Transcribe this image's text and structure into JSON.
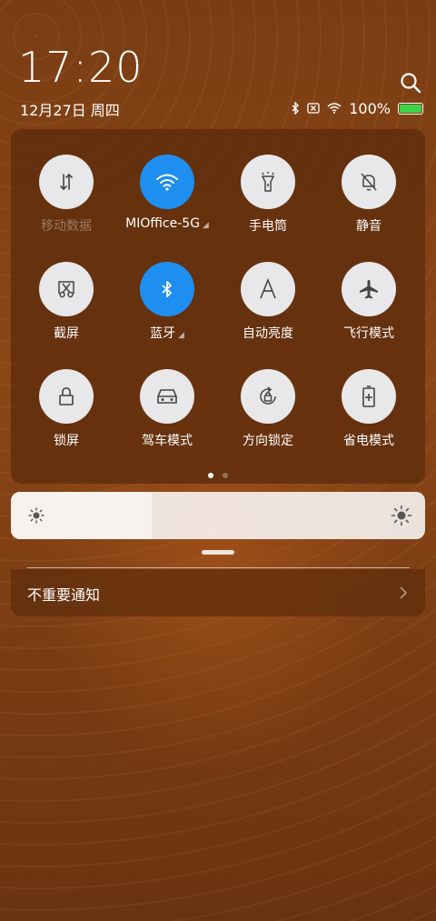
{
  "status": {
    "time": "17:20",
    "date": "12月27日 周四",
    "battery": "100%",
    "battery_level": 1.0,
    "battery_color": "#3ed44a"
  },
  "tiles": [
    {
      "label": "移动数据",
      "icon": "mobile-data-icon",
      "active": false,
      "dim": true
    },
    {
      "label": "MIOffice-5G",
      "icon": "wifi-icon",
      "active": true,
      "sub_indicator": true
    },
    {
      "label": "手电筒",
      "icon": "flashlight-icon",
      "active": false
    },
    {
      "label": "静音",
      "icon": "mute-bell-icon",
      "active": false
    },
    {
      "label": "截屏",
      "icon": "screenshot-scissors-icon",
      "active": false
    },
    {
      "label": "蓝牙",
      "icon": "bluetooth-icon",
      "active": true,
      "sub_indicator": true
    },
    {
      "label": "自动亮度",
      "icon": "auto-brightness-icon",
      "active": false
    },
    {
      "label": "飞行模式",
      "icon": "airplane-icon",
      "active": false
    },
    {
      "label": "锁屏",
      "icon": "lock-icon",
      "active": false
    },
    {
      "label": "驾车模式",
      "icon": "car-icon",
      "active": false
    },
    {
      "label": "方向锁定",
      "icon": "rotation-lock-icon",
      "active": false
    },
    {
      "label": "省电模式",
      "icon": "battery-saver-icon",
      "active": false
    }
  ],
  "pages": {
    "count": 2,
    "current": 1
  },
  "brightness": {
    "level": 0.34
  },
  "notifications": {
    "unimportant_label": "不重要通知"
  },
  "colors": {
    "accent": "#1e8ef0",
    "tile_bg": "#e8e8ea",
    "icon_dark": "#444444"
  }
}
